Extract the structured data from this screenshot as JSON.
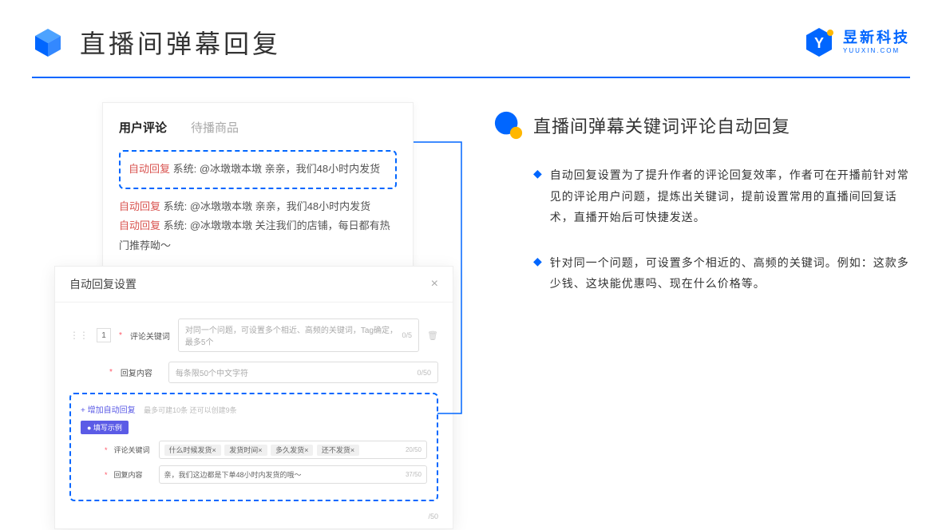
{
  "header": {
    "title": "直播间弹幕回复",
    "brand_name": "昱新科技",
    "brand_sub": "YUUXIN.COM"
  },
  "comment_panel": {
    "tabs": [
      "用户评论",
      "待播商品"
    ],
    "items": [
      {
        "tag": "自动回复",
        "text": " 系统: @冰墩墩本墩 亲亲，我们48小时内发货"
      },
      {
        "tag": "自动回复",
        "text": " 系统: @冰墩墩本墩 亲亲，我们48小时内发货"
      },
      {
        "tag": "自动回复",
        "text": " 系统: @冰墩墩本墩 关注我们的店铺，每日都有热门推荐呦～"
      }
    ]
  },
  "settings": {
    "title": "自动回复设置",
    "row_num": "1",
    "keyword_label": "评论关键词",
    "keyword_placeholder": "对同一个问题，可设置多个相近、高频的关键词，Tag确定，最多5个",
    "keyword_count": "0/5",
    "reply_label": "回复内容",
    "reply_placeholder": "每条限50个中文字符",
    "reply_count": "0/50",
    "add_label": "+ 增加自动回复",
    "add_hint": "最多可建10条 还可以创建9条",
    "example_badge": "● 填写示例",
    "ex_keyword_label": "评论关键词",
    "ex_tags": [
      "什么时候发货×",
      "发货时间×",
      "多久发货×",
      "还不发货×"
    ],
    "ex_keyword_count": "20/50",
    "ex_reply_label": "回复内容",
    "ex_reply_text": "亲，我们这边都是下单48小时内发货的哦～",
    "ex_reply_count": "37/50",
    "bottom_count": "/50"
  },
  "right": {
    "heading": "直播间弹幕关键词评论自动回复",
    "bullets": [
      "自动回复设置为了提升作者的评论回复效率，作者可在开播前针对常见的评论用户问题，提炼出关键词，提前设置常用的直播间回复话术，直播开始后可快捷发送。",
      "针对同一个问题，可设置多个相近的、高频的关键词。例如：这款多少钱、这块能优惠吗、现在什么价格等。"
    ]
  }
}
